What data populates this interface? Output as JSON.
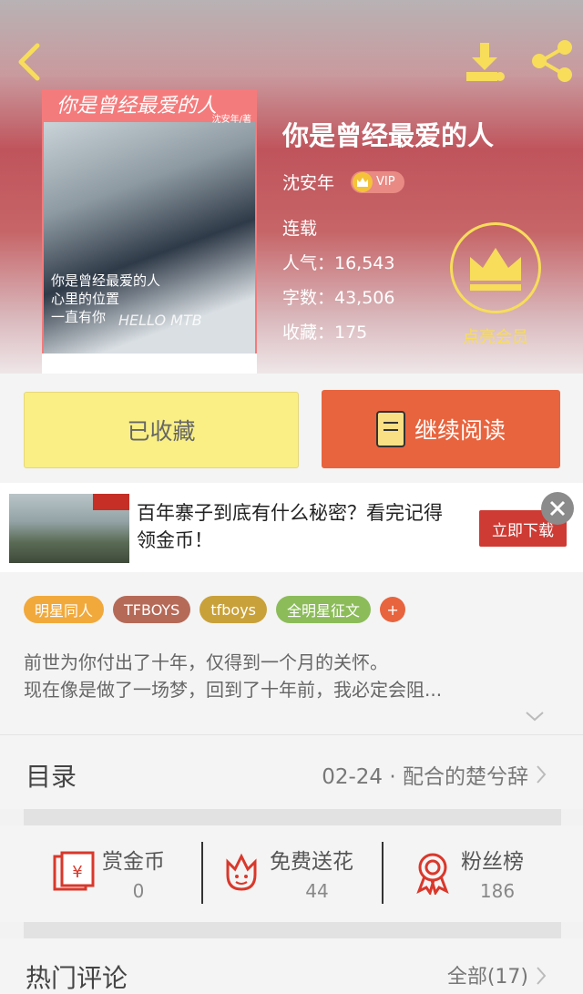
{
  "book": {
    "title": "你是曾经最爱的人",
    "author": "沈安年",
    "vip_label": "VIP",
    "status": "连载",
    "popularity": "人气：16,543",
    "word_count": "字数：43,506",
    "favorites": "收藏：175",
    "cover_title": "你是曾经最爱的人",
    "cover_author": "沈安年/著",
    "cover_line1": "你是曾经最爱的人",
    "cover_line2": "心里的位置",
    "cover_line3": "一直有你",
    "cover_brand": "HELLO MTB"
  },
  "member": {
    "label": "点亮会员"
  },
  "actions": {
    "collected_label": "已收藏",
    "read_label": "继续阅读"
  },
  "ad": {
    "text": "百年寨子到底有什么秘密？看完记得领金币！",
    "download_label": "立即下载"
  },
  "tags": [
    "明星同人",
    "TFBOYS",
    "tfboys",
    "全明星征文",
    "+"
  ],
  "tag_colors": [
    "#f1a93c",
    "#b56a58",
    "#c9a13a",
    "#8cbc5a"
  ],
  "description": {
    "line1": "前世为你付出了十年，仅得到一个月的关怀。",
    "line2": "现在像是做了一场梦，回到了十年前，我必定会阻..."
  },
  "toc": {
    "label": "目录",
    "latest": "02-24 · 配合的楚兮辞"
  },
  "stats": {
    "reward": {
      "label": "赏金币",
      "value": "0"
    },
    "flower": {
      "label": "免费送花",
      "value": "44"
    },
    "fans": {
      "label": "粉丝榜",
      "value": "186"
    }
  },
  "comments": {
    "label": "热门评论",
    "all": "全部(17)"
  },
  "colors": {
    "accent": "#e8643e",
    "yellow": "#f9ef85",
    "gold": "#f7dd5a",
    "red_icon": "#d9382b"
  }
}
